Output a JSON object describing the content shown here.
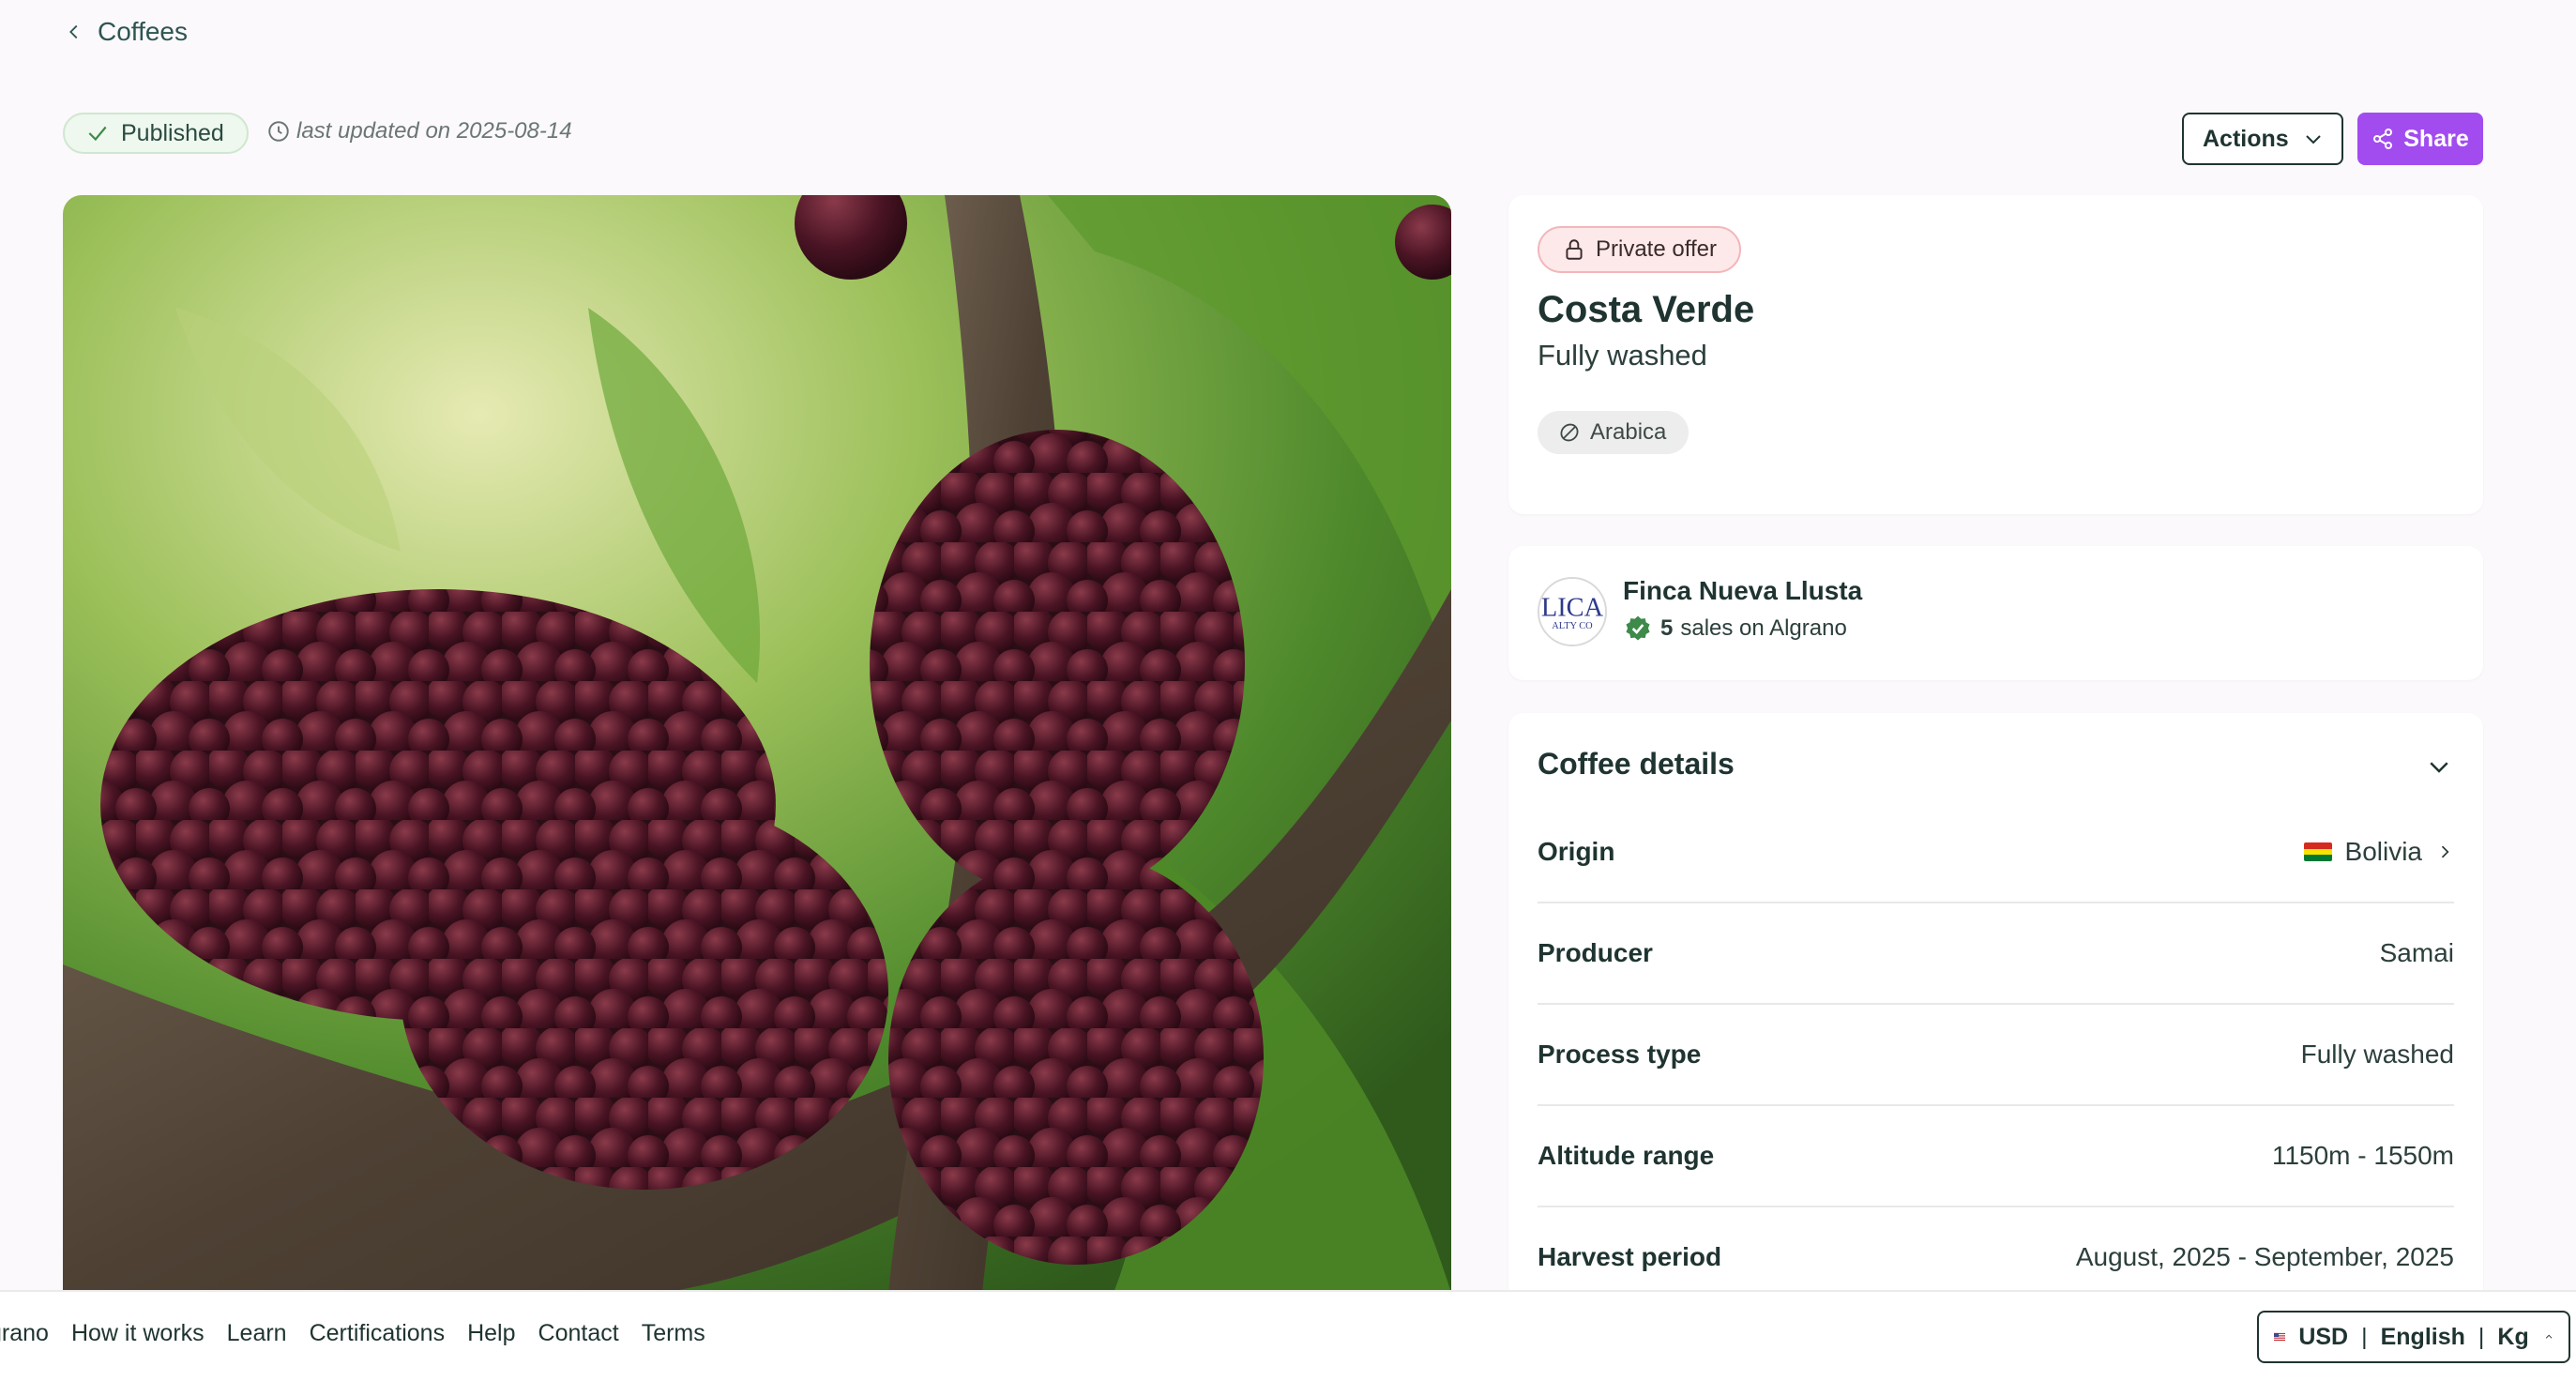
{
  "nav": {
    "back_label": "Coffees"
  },
  "status": {
    "published_label": "Published",
    "updated_text": "last updated on 2025-08-14"
  },
  "toolbar": {
    "actions_label": "Actions",
    "share_label": "Share"
  },
  "offer": {
    "private_label": "Private offer",
    "name": "Costa Verde",
    "process": "Fully washed",
    "variety": "Arabica"
  },
  "seller": {
    "name": "Finca Nueva Llusta",
    "sales_count": "5",
    "sales_suffix": "sales on Algrano",
    "logo_text": "LICA",
    "logo_subtext": "ALTY CO"
  },
  "details": {
    "title": "Coffee details",
    "rows": [
      {
        "label": "Origin",
        "value": "Bolivia"
      },
      {
        "label": "Producer",
        "value": "Samai"
      },
      {
        "label": "Process type",
        "value": "Fully washed"
      },
      {
        "label": "Altitude range",
        "value": "1150m - 1550m"
      },
      {
        "label": "Harvest period",
        "value": "August, 2025 - September, 2025"
      }
    ]
  },
  "footer": {
    "links": [
      "grano",
      "How it works",
      "Learn",
      "Certifications",
      "Help",
      "Contact",
      "Terms"
    ],
    "currency": "USD",
    "language": "English",
    "unit": "Kg"
  },
  "colors": {
    "accent": "#a24cf0",
    "text": "#1f3431",
    "published_bg": "#eef8ee",
    "private_bg": "#fde9ea"
  }
}
